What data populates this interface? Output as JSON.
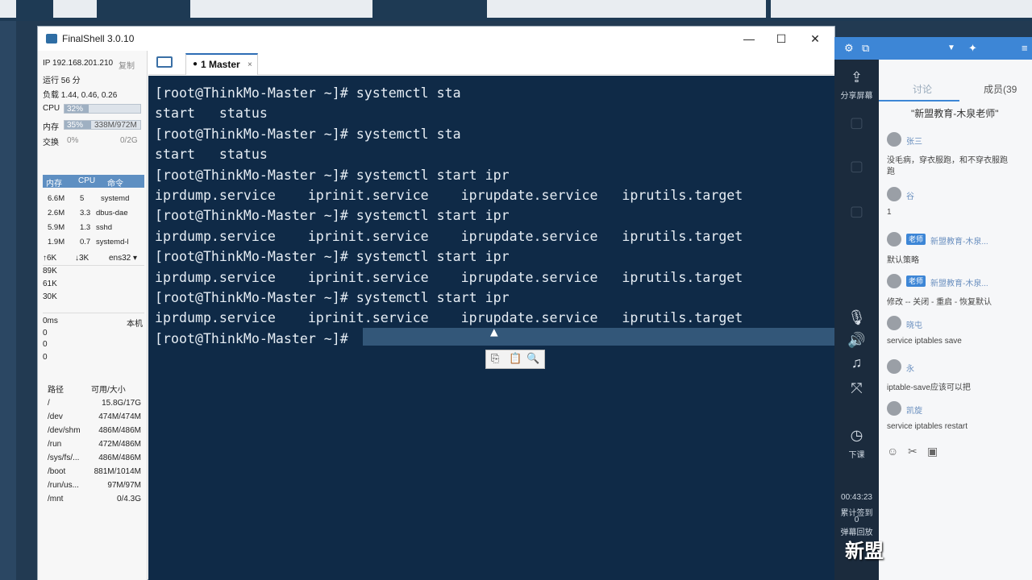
{
  "window": {
    "title": "FinalShell 3.0.10",
    "minimize": "—",
    "maximize": "☐",
    "close": "✕"
  },
  "status": {
    "ip_label": "IP 192.168.201.210",
    "ip_action": "复制",
    "uptime": "运行 56 分",
    "load": "负载 1.44, 0.46, 0.26",
    "cpu_label": "CPU",
    "cpu_value": "32%",
    "cpu_fraction": 0.32,
    "mem_label": "内存",
    "mem_percent": "35%",
    "mem_fraction": 0.35,
    "mem_detail": "338M/972M",
    "swap_label": "交换",
    "swap_percent": "0%",
    "swap_fraction": 0,
    "swap_detail": "0/2G",
    "proc_tabs": [
      "内存",
      "CPU",
      "命令"
    ],
    "processes": [
      {
        "mem": "6.6M",
        "cpu": "5",
        "cmd": "systemd"
      },
      {
        "mem": "2.6M",
        "cpu": "3.3",
        "cmd": "dbus-dae"
      },
      {
        "mem": "5.9M",
        "cpu": "1.3",
        "cmd": "sshd"
      },
      {
        "mem": "1.9M",
        "cpu": "0.7",
        "cmd": "systemd-l"
      }
    ],
    "net_up": "6K",
    "net_down": "3K",
    "net_iface": "ens32",
    "net_scale": [
      "89K",
      "61K",
      "30K"
    ],
    "latency_label": "0ms",
    "latency_host": "本机",
    "latency_values": [
      "0",
      "0",
      "0"
    ],
    "disk_header_path": "路径",
    "disk_header_size": "可用/大小",
    "disks": [
      {
        "path": "/",
        "size": "15.8G/17G"
      },
      {
        "path": "/dev",
        "size": "474M/474M"
      },
      {
        "path": "/dev/shm",
        "size": "486M/486M"
      },
      {
        "path": "/run",
        "size": "472M/486M"
      },
      {
        "path": "/sys/fs/...",
        "size": "486M/486M"
      },
      {
        "path": "/boot",
        "size": "881M/1014M"
      },
      {
        "path": "/run/us...",
        "size": "97M/97M"
      },
      {
        "path": "/mnt",
        "size": "0/4.3G"
      }
    ]
  },
  "tabs": {
    "active_label": "1 Master",
    "dot": "●",
    "close": "×"
  },
  "terminal": {
    "lines": [
      "[root@ThinkMo-Master ~]# systemctl sta",
      "start   status",
      "[root@ThinkMo-Master ~]# systemctl sta",
      "start   status",
      "[root@ThinkMo-Master ~]# systemctl start ipr",
      "iprdump.service    iprinit.service    iprupdate.service   iprutils.target",
      "[root@ThinkMo-Master ~]# systemctl start ipr",
      "iprdump.service    iprinit.service    iprupdate.service   iprutils.target",
      "[root@ThinkMo-Master ~]# systemctl start ipr",
      "iprdump.service    iprinit.service    iprupdate.service   iprutils.target",
      "[root@ThinkMo-Master ~]# systemctl start ipr",
      "iprdump.service    iprinit.service    iprupdate.service   iprutils.target",
      "[root@ThinkMo-Master ~]# "
    ],
    "toolbar": [
      "⎘",
      "📋",
      "🔍"
    ]
  },
  "classroom": {
    "share_screen": "分享屏幕",
    "tab_discussion": "讨论",
    "tab_members": "成员(39",
    "room_title": "\"新盟教育-木泉老师\"",
    "end_class": "下课",
    "timer": "00:43:23",
    "stat1": "累计签到",
    "stat1_value": "0",
    "stat2": "弹幕回放",
    "watermark": "新盟",
    "messages": [
      {
        "name": "张三",
        "text": "没毛病，穿衣服跑，和不穿衣服跑",
        "text2": "跑"
      },
      {
        "name": "谷",
        "text": "1"
      },
      {
        "name": "新盟教育-木泉...",
        "badge": "老师",
        "text": "默认策略"
      },
      {
        "name": "新盟教育-木泉...",
        "badge": "老师",
        "text": "修改 -- 关闭 - 重启 - 恢复默认"
      },
      {
        "name": "晓屯",
        "text": "service iptables save"
      },
      {
        "name": "永",
        "text": "iptable-save应该可以把"
      },
      {
        "name": "凯旋",
        "text": "service iptables restart"
      }
    ]
  }
}
